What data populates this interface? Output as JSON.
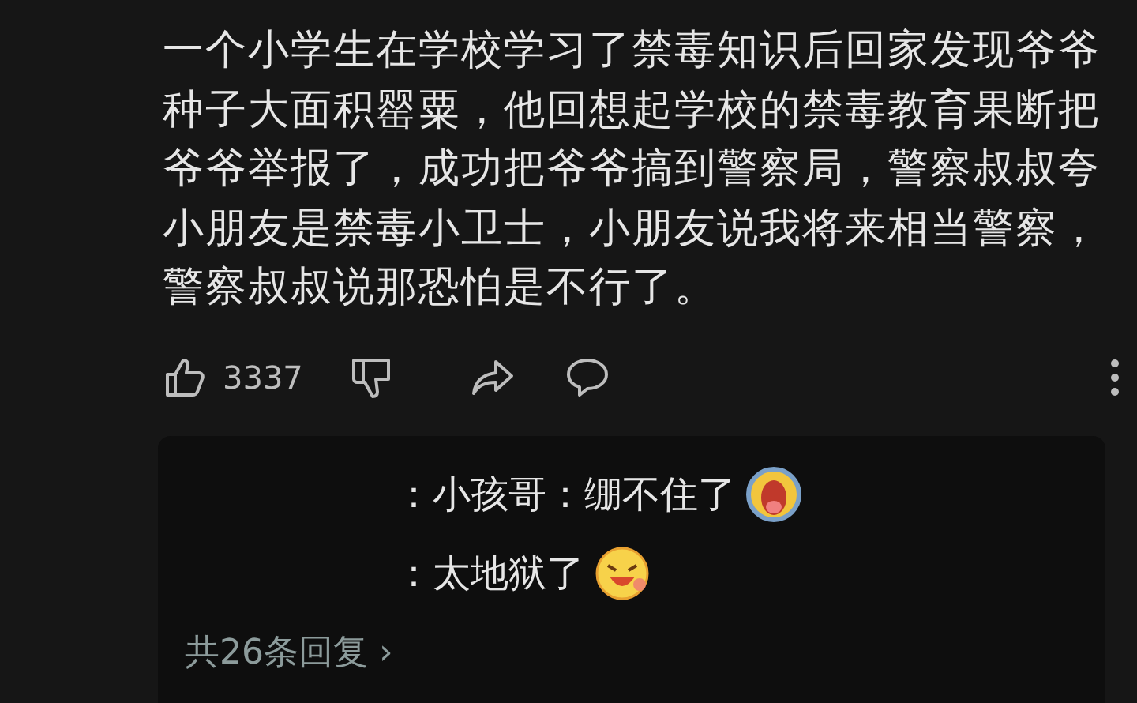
{
  "comment": {
    "lines": [
      "一个小学生在学校学习了禁毒知识后回家发现爷爷",
      "种子大面积罂粟，他回想起学校的禁毒教育果断把",
      "爷爷举报了，成功把爷爷搞到警察局，警察叔叔夸",
      "小朋友是禁毒小卫士，小朋友说我将来相当警察，",
      "警察叔叔说那恐怕是不行了。"
    ],
    "like_count": "3337"
  },
  "replies": [
    {
      "text": "：小孩哥：绷不住了",
      "kind": "crying"
    },
    {
      "text": "：太地狱了",
      "kind": "laughing"
    }
  ],
  "more_replies": "共26条回复 ›"
}
